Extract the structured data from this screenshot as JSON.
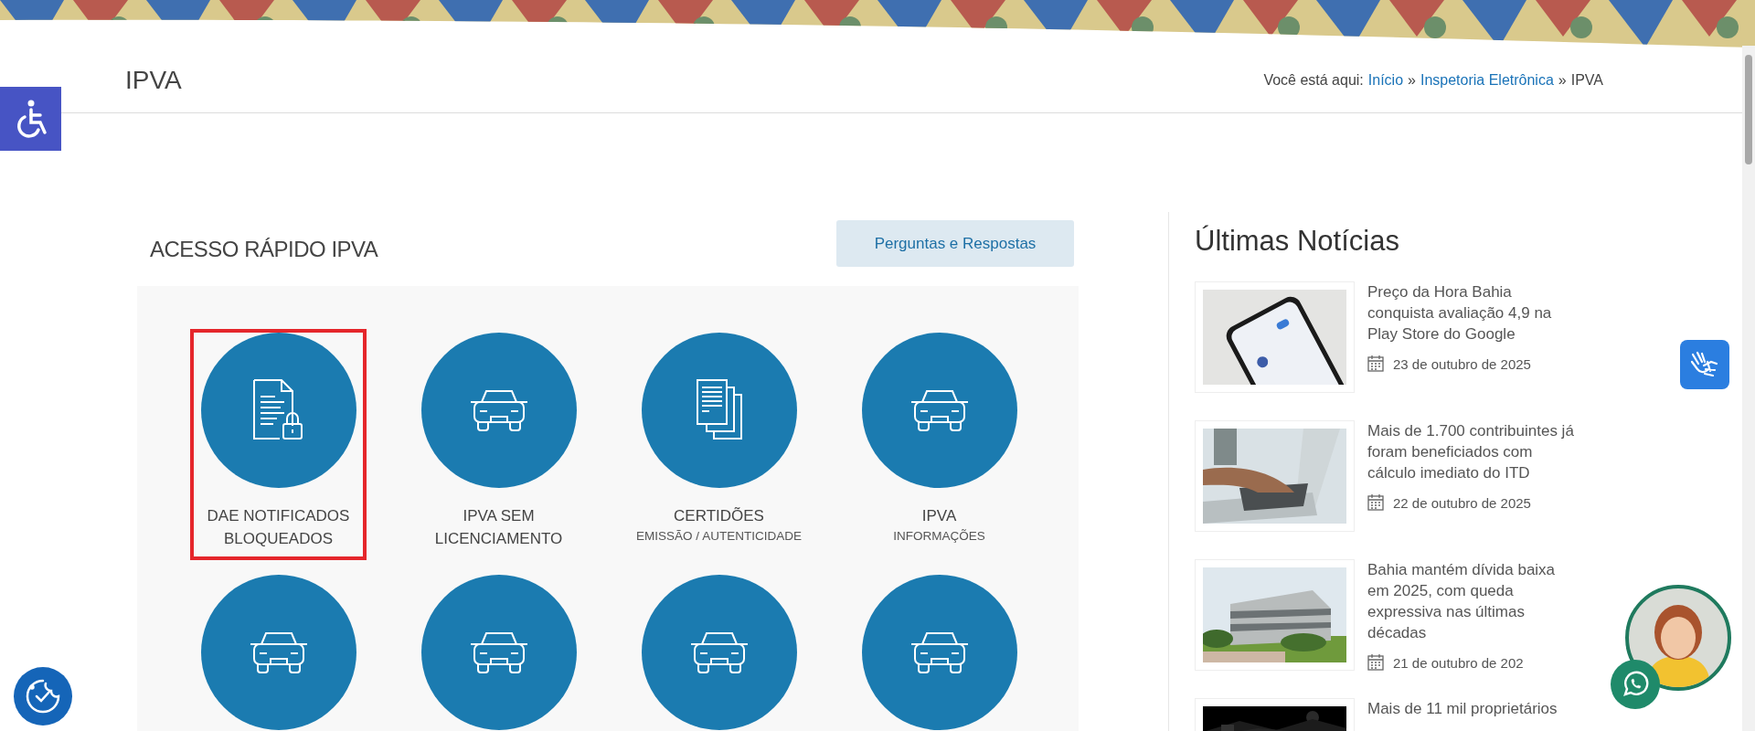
{
  "page_title": "IPVA",
  "breadcrumb": {
    "prefix": "Você está aqui:",
    "items": [
      {
        "label": "Início",
        "link": true
      },
      {
        "separator": "»",
        "label": "Inspetoria Eletrônica",
        "link": true
      },
      {
        "separator": "»",
        "label": "IPVA",
        "link": false
      }
    ]
  },
  "quick_access": {
    "title": "ACESSO RÁPIDO IPVA",
    "faq_button": "Perguntas e Respostas",
    "tiles": [
      {
        "kind": "document-lock",
        "title": "DAE NOTIFICADOS BLOQUEADOS",
        "highlighted": true
      },
      {
        "kind": "car",
        "title": "IPVA SEM LICENCIAMENTO",
        "highlighted": false
      },
      {
        "kind": "documents",
        "title": "CERTIDÕES",
        "subtitle": "EMISSÃO / AUTENTICIDADE",
        "highlighted": false
      },
      {
        "kind": "car",
        "title": "IPVA",
        "subtitle": "INFORMAÇÕES",
        "highlighted": false
      },
      {
        "kind": "car",
        "highlighted": false
      },
      {
        "kind": "car",
        "highlighted": false
      },
      {
        "kind": "car",
        "highlighted": false
      },
      {
        "kind": "car",
        "highlighted": false
      }
    ]
  },
  "news": {
    "title": "Últimas Notícias",
    "items": [
      {
        "title": "Preço da Hora Bahia conquista avaliação 4,9 na Play Store do Google",
        "date": "23 de outubro de 2025"
      },
      {
        "title": "Mais de 1.700 contribuintes já foram beneficiados com cálculo imediato do ITD",
        "date": "22 de outubro de 2025"
      },
      {
        "title": "Bahia mantém dívida baixa em 2025, com queda expressiva nas últimas décadas",
        "date": "21 de outubro de 202"
      },
      {
        "title": "Mais de 11 mil proprietários"
      }
    ]
  }
}
